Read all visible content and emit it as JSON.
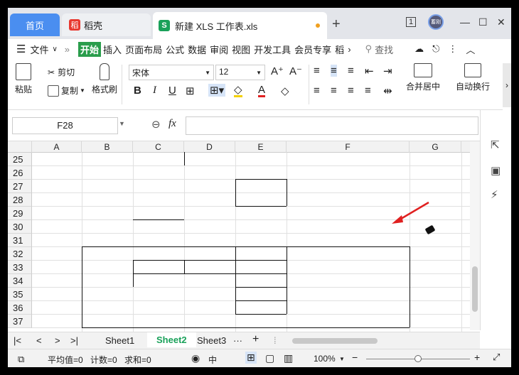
{
  "titlebar": {
    "home_tab": "首页",
    "docer_tab": "稻壳",
    "doc_tab": "新建 XLS 工作表.xls",
    "s_glyph": "S",
    "docer_glyph": "稻",
    "new_tab": "+",
    "window_count": "1",
    "avatar": "蓄刚",
    "min": "—",
    "max": "☐",
    "close": "✕"
  },
  "menu": {
    "file": "文件",
    "items": [
      "开始",
      "插入",
      "页面布局",
      "公式",
      "数据",
      "审阅",
      "视图",
      "开发工具",
      "会员专享",
      "稻"
    ],
    "search": "查找"
  },
  "ribbon": {
    "paste": "粘贴",
    "cut": "剪切",
    "copy": "复制",
    "format_painter": "格式刷",
    "font": "宋体",
    "size": "12",
    "bold": "B",
    "italic": "I",
    "underline": "U",
    "merge": "合并居中",
    "wrap": "自动换行"
  },
  "formula": {
    "cell_ref": "F28",
    "fx": "fx"
  },
  "grid": {
    "columns": [
      "A",
      "B",
      "C",
      "D",
      "E",
      "F",
      "G"
    ],
    "rows": [
      "25",
      "26",
      "27",
      "28",
      "29",
      "30",
      "31",
      "32",
      "33",
      "34",
      "35",
      "36",
      "37"
    ]
  },
  "sheets": {
    "tabs": [
      "Sheet1",
      "Sheet2",
      "Sheet3"
    ],
    "active": "Sheet2",
    "more": "···",
    "add": "+"
  },
  "status": {
    "avg": "平均值=0",
    "count": "计数=0",
    "sum": "求和=0",
    "ime": "中",
    "zoom": "100%"
  },
  "colors": {
    "accent": "#4a8ef0",
    "active_sheet": "#1aa15a",
    "arrow": "#e02020"
  }
}
